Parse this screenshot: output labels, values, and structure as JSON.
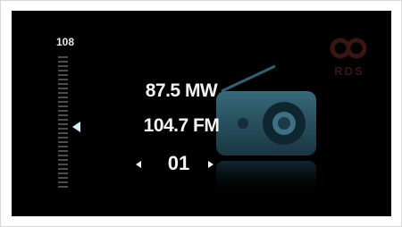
{
  "scale": {
    "max_label": "108"
  },
  "readings": {
    "mw": "87.5 MW",
    "fm": "104.7 FM"
  },
  "preset": {
    "number": "01"
  },
  "logo": {
    "text": "RDS"
  },
  "icons": {
    "scale_pointer": "triangle-left-icon",
    "preset_prev": "triangle-left-icon",
    "preset_next": "triangle-right-icon",
    "radio": "radio-icon"
  },
  "colors": {
    "background": "#000000",
    "text": "#f4f4f4",
    "accent": "#7fd0ea",
    "radio_glow": "#2a5a6c"
  }
}
